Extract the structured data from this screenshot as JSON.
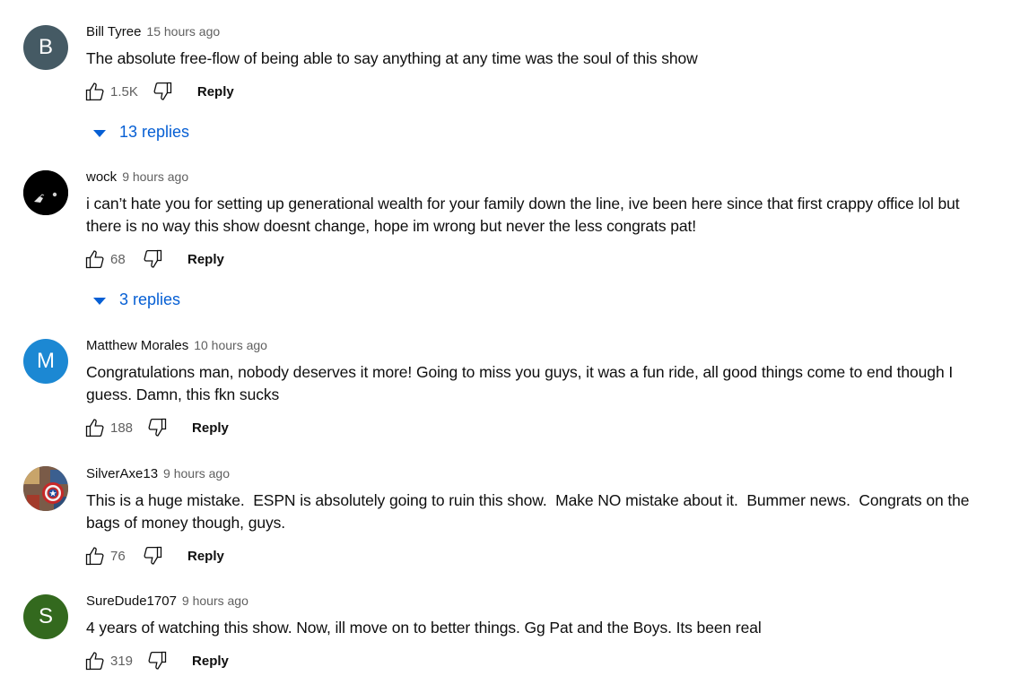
{
  "comments": [
    {
      "author": "Bill Tyree",
      "time": "15 hours ago",
      "text": "The absolute free-flow of being able to say anything at any time was the soul of this show",
      "likes": "1.5K",
      "reply_label": "Reply",
      "avatar_letter": "B",
      "avatar_color": "#455a64",
      "replies": "13 replies"
    },
    {
      "author": "wock",
      "time": "9 hours ago",
      "text": "i can’t hate you for setting up generational wealth for your family down the line, ive been here since that first crappy office lol but there is no way this show doesnt change, hope im wrong but never the less congrats pat!",
      "likes": "68",
      "reply_label": "Reply",
      "avatar_color": "#000000",
      "replies": "3 replies"
    },
    {
      "author": "Matthew Morales",
      "time": "10 hours ago",
      "text": "Congratulations man, nobody deserves it more! Going to miss you guys, it was a fun ride, all good things come to end though I guess. Damn, this fkn sucks",
      "likes": "188",
      "reply_label": "Reply",
      "avatar_letter": "M",
      "avatar_color": "#1c88d3"
    },
    {
      "author": "SilverAxe13",
      "time": "9 hours ago",
      "text": "This is a huge mistake.  ESPN is absolutely going to ruin this show.  Make NO mistake about it.  Bummer news.  Congrats on the bags of money though, guys.",
      "likes": "76",
      "reply_label": "Reply"
    },
    {
      "author": "SureDude1707",
      "time": "9 hours ago",
      "text": "4 years of watching this show. Now, ill move on to better things. Gg Pat and the Boys. Its been real",
      "likes": "319",
      "reply_label": "Reply",
      "avatar_letter": "S",
      "avatar_color": "#33691e"
    }
  ],
  "icons": {
    "like": "thumbs-up-icon",
    "dislike": "thumbs-down-icon",
    "replies_toggle": "caret-down-icon"
  },
  "colors": {
    "link_blue": "#065fd4",
    "secondary_text": "#606060"
  }
}
